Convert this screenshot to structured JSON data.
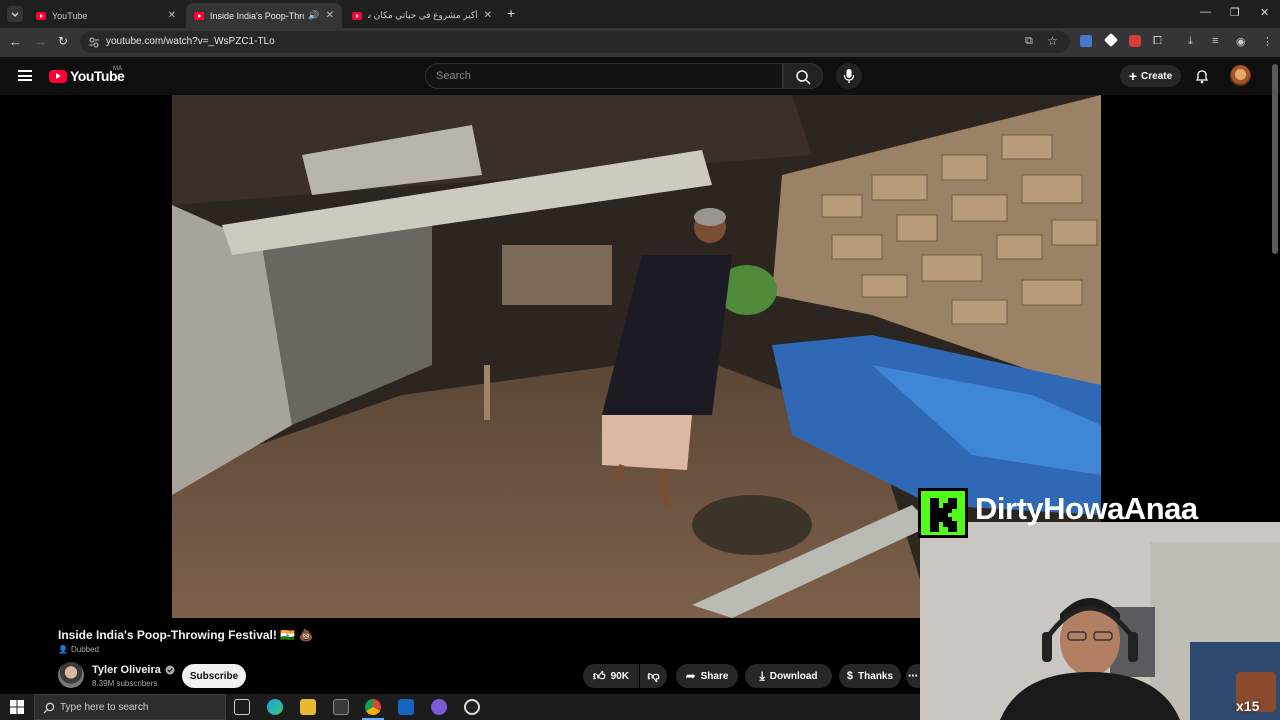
{
  "browser": {
    "tabs": [
      {
        "title": "YouTube",
        "active": false
      },
      {
        "title": "Inside India's Poop-Throwin",
        "active": true
      },
      {
        "title": "أكبر مشروع في حياتي مكان ساو",
        "active": false
      }
    ],
    "url": "youtube.com/watch?v=_WsPZC1-TLo"
  },
  "youtube": {
    "logo_text": "YouTube",
    "country_code": "MA",
    "search_placeholder": "Search",
    "create_label": "Create"
  },
  "video": {
    "title": "Inside India's Poop-Throwing Festival! 🇮🇳 💩",
    "dubbed_label": "Dubbed",
    "channel_name": "Tyler Oliveira",
    "subscribers": "8.39M subscribers",
    "subscribe_label": "Subscribe",
    "likes": "90K",
    "share_label": "Share",
    "download_label": "Download",
    "thanks_label": "Thanks"
  },
  "overlay": {
    "streamer_name": "DirtyHowaAnaa",
    "gift_count": "x15"
  },
  "taskbar": {
    "search_placeholder": "Type here to search"
  },
  "colors": {
    "youtube_red": "#ff0033",
    "kick_green": "#53fc18",
    "page_background": "#0f0f0f"
  }
}
